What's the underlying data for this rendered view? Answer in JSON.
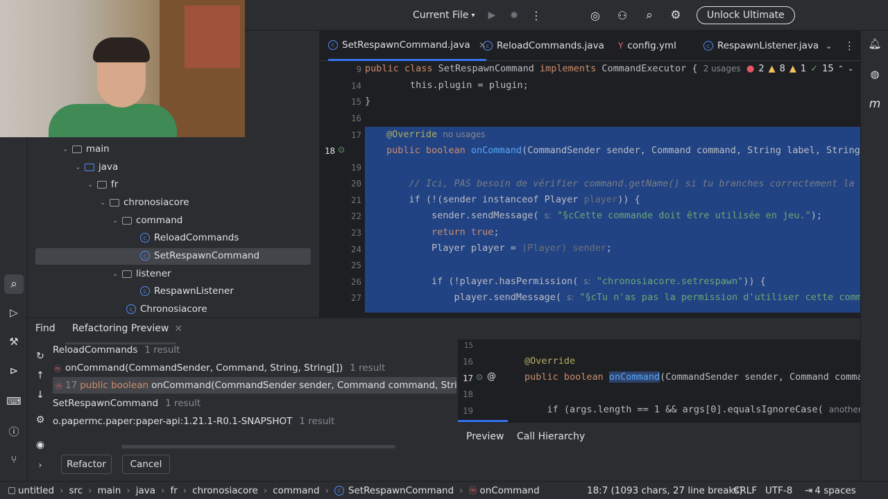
{
  "toolbar": {
    "run_config": "Current File",
    "unlock": "Unlock Ultimate"
  },
  "tabs": [
    {
      "label": "SetRespawnCommand.java"
    },
    {
      "label": "ReloadCommands.java"
    },
    {
      "label": "config.yml"
    },
    {
      "label": "RespawnListener.java"
    }
  ],
  "project_tree": [
    {
      "label": "main"
    },
    {
      "label": "java"
    },
    {
      "label": "fr"
    },
    {
      "label": "chronosiacore"
    },
    {
      "label": "command"
    },
    {
      "label": "ReloadCommands"
    },
    {
      "label": "SetRespawnCommand"
    },
    {
      "label": "listener"
    },
    {
      "label": "RespawnListener"
    },
    {
      "label": "Chronosiacore"
    }
  ],
  "editor": {
    "usages_hint": "2 usages",
    "no_usages": "no usages",
    "inspections": {
      "errors": "2",
      "warnings": "8",
      "weak": "1",
      "typos": "15"
    },
    "line_numbers": [
      "9",
      "14",
      "15",
      "16",
      "17",
      "18",
      "19",
      "20",
      "21",
      "22",
      "23",
      "24",
      "25",
      "26",
      "27"
    ],
    "lines": {
      "l9_a": "public class ",
      "l9_b": "SetRespawnCommand",
      "l9_c": " implements ",
      "l9_d": "CommandExecutor {",
      "l14": "    this.plugin = plugin;",
      "l15": "}",
      "l17": "@Override",
      "l18_a": "public boolean ",
      "l18_b": "onCommand",
      "l18_c": "(CommandSender sender, Command command, String label, String[] ar",
      "l20": "    // Ici, PAS besoin de vérifier command.getName() si tu branches correctement la comma",
      "l21_a": "    if (!(sender instanceof Player ",
      "l21_b": "player",
      "l21_c": ")) {",
      "l22_a": "        sender.sendMessage( ",
      "l22_hint": "s:",
      "l22_b": "\"§cCette commande doit être utilisée en jeu.\"",
      "l22_c": ");",
      "l23_a": "        return ",
      "l23_b": "true",
      "l23_c": ";",
      "l24_a": "        Player player = ",
      "l24_b": "(Player) sender",
      "l24_c": ";",
      "l26_a": "        if (!player.hasPermission( ",
      "l26_hint": "s:",
      "l26_b": "\"chronosiacore.setrespawn\"",
      "l26_c": ")) {",
      "l27_a": "            player.sendMessage( ",
      "l27_hint": "s:",
      "l27_b": "\"§cTu n'as pas la permission d'utiliser cette commande."
    }
  },
  "find_panel": {
    "tab_find": "Find",
    "tab_refactoring": "Refactoring Preview",
    "results": [
      {
        "label": "ReloadCommands",
        "count": "1 result"
      },
      {
        "label": "onCommand(CommandSender, Command, String, String[])",
        "count": "1 result"
      },
      {
        "line": "17",
        "label_a": "public boolean",
        "label_b": "onCommand(CommandSender sender, Command command, String label, S"
      },
      {
        "label": "SetRespawnCommand",
        "count": "1 result"
      },
      {
        "label": "o.papermc.paper:paper-api:1.21.1-R0.1-SNAPSHOT",
        "count": "1 result"
      }
    ],
    "refactor_button": "Refactor",
    "cancel_button": "Cancel",
    "preview_tab": "Preview",
    "call_hierarchy_tab": "Call Hierarchy",
    "preview_lines": [
      "15",
      "16",
      "17",
      "18",
      "19"
    ],
    "preview_code": {
      "p16": "@Override",
      "p17_a": "public boolean ",
      "p17_b": "onCommand",
      "p17_c": "(CommandSender sender, Command command,",
      "p19_a": "    if (args.length == 1 && args[0].equalsIgnoreCase( ",
      "p19_hint": "anotherStrin"
    }
  },
  "statusbar": {
    "breadcrumbs": [
      "untitled",
      "src",
      "main",
      "java",
      "fr",
      "chronosiacore",
      "command",
      "SetRespawnCommand",
      "onCommand"
    ],
    "position": "18:7 (1093 chars, 27 line breaks)",
    "line_sep": "CRLF",
    "encoding": "UTF-8",
    "indent": "4 spaces"
  }
}
